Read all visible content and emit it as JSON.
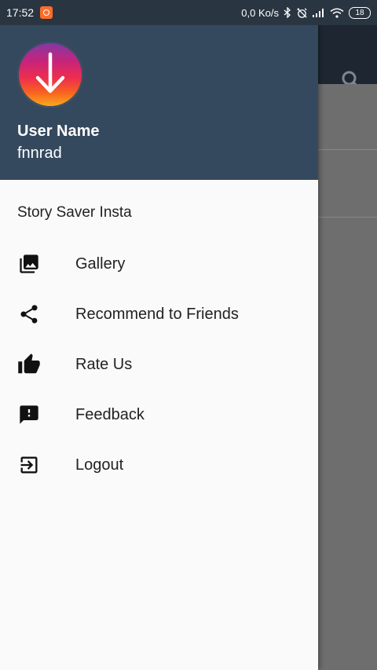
{
  "status_bar": {
    "time": "17:52",
    "network_speed": "0,0 Ko/s",
    "battery": "18",
    "icons": [
      "app-notification-icon",
      "bluetooth-icon",
      "no-alarm-icon",
      "signal-icon",
      "wifi-icon",
      "battery-icon"
    ]
  },
  "drawer": {
    "header": {
      "user_label": "User Name",
      "username": "fnnrad"
    },
    "section_title": "Story Saver Insta",
    "items": [
      {
        "label": "Gallery",
        "icon": "gallery-icon"
      },
      {
        "label": "Recommend to Friends",
        "icon": "share-icon"
      },
      {
        "label": "Rate Us",
        "icon": "thumb-up-icon"
      },
      {
        "label": "Feedback",
        "icon": "feedback-icon"
      },
      {
        "label": "Logout",
        "icon": "logout-icon"
      }
    ]
  },
  "background": {
    "toolbar_icon": "search-icon"
  },
  "colors": {
    "header_bg": "#34495e",
    "status_bar_bg": "#2a3542",
    "drawer_bg": "#fafafa",
    "scrim": "#6e6e6e"
  }
}
